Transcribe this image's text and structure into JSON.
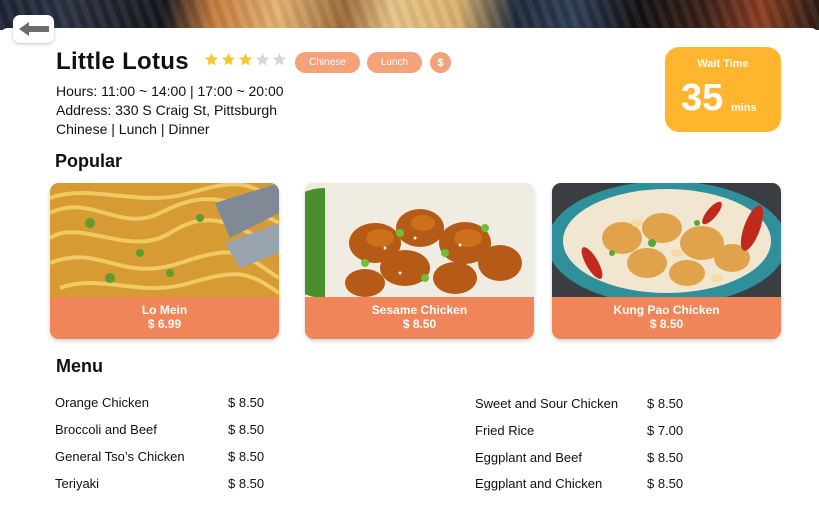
{
  "restaurant": {
    "name": "Little Lotus",
    "rating": 3,
    "rating_max": 5,
    "tags": [
      "Chinese",
      "Lunch",
      "$"
    ],
    "hours": "Hours: 11:00 ~ 14:00 | 17:00 ~ 20:00",
    "address": "Address: 330 S Craig St, Pittsburgh",
    "cuisine": "Chinese | Lunch | Dinner"
  },
  "wait": {
    "label": "Wait Time",
    "value": "35",
    "unit": "mins"
  },
  "popular": {
    "title": "Popular",
    "items": [
      {
        "name": "Lo Mein",
        "price": "$ 6.99",
        "image": "lo-mein-photo"
      },
      {
        "name": "Sesame Chicken",
        "price": "$ 8.50",
        "image": "sesame-chicken-photo"
      },
      {
        "name": "Kung Pao Chicken",
        "price": "$ 8.50",
        "image": "kung-pao-chicken-photo"
      }
    ]
  },
  "menu": {
    "title": "Menu",
    "left": [
      {
        "name": "Orange Chicken",
        "price": "$ 8.50"
      },
      {
        "name": "Broccoli and Beef",
        "price": "$ 8.50"
      },
      {
        "name": "General Tso’s Chicken",
        "price": "$ 8.50"
      },
      {
        "name": "Teriyaki",
        "price": "$ 8.50"
      }
    ],
    "right": [
      {
        "name": "Sweet and Sour Chicken",
        "price": "$ 8.50"
      },
      {
        "name": "Fried Rice",
        "price": "$ 7.00"
      },
      {
        "name": "Eggplant and Beef",
        "price": "$ 8.50"
      },
      {
        "name": "Eggplant and Chicken",
        "price": "$ 8.50"
      }
    ]
  },
  "colors": {
    "accent": "#f0855a",
    "tag": "#f4a27a",
    "wait_bg": "#ffb52e",
    "star_on": "#f7c531",
    "star_off": "#d6d6d6"
  },
  "icons": {
    "back": "back-arrow-icon",
    "star": "star-icon"
  }
}
